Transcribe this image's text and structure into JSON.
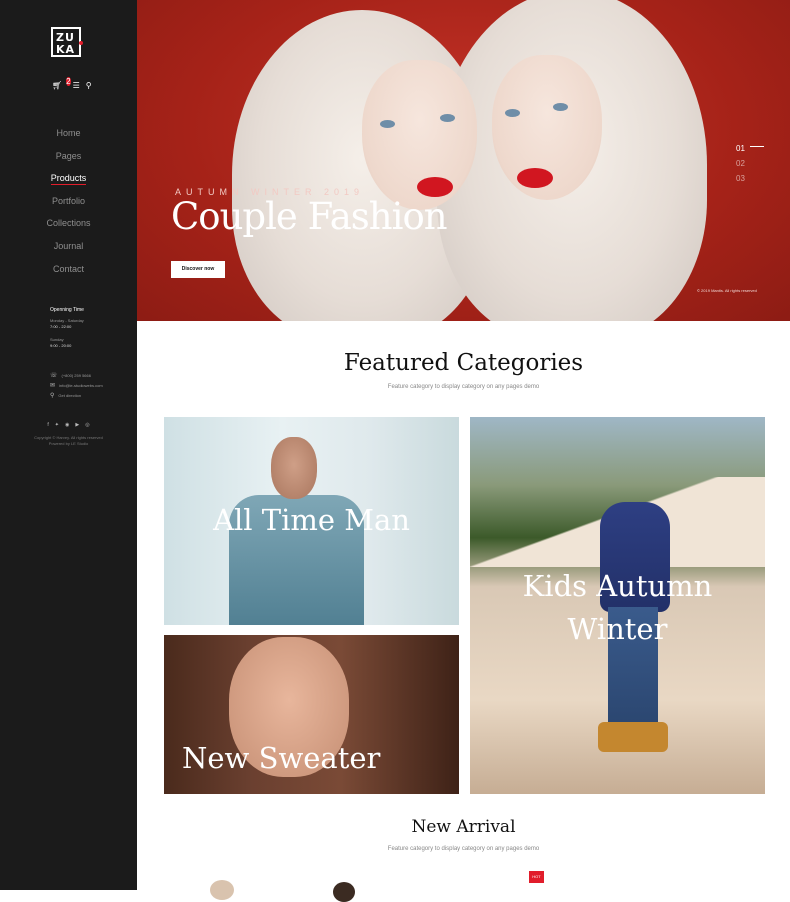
{
  "brand": {
    "line1": "ZU",
    "line2": "KA"
  },
  "header_icons": {
    "cart_count": "2"
  },
  "nav": [
    "Home",
    "Pages",
    "Products",
    "Portfolio",
    "Collections",
    "Journal",
    "Contact"
  ],
  "active_nav": "Products",
  "opening": {
    "title": "Openning Time",
    "weekdays": "Monday - Saturday",
    "weekday_hours": "7:00 - 22:00",
    "sunday": "Sunday",
    "sunday_hours": "9:00 - 20:00"
  },
  "contact": {
    "phone": "(+800) 259 5666",
    "email": "info@le-studiowebs.com",
    "direction": "Get direction"
  },
  "copyright": {
    "line1": "Copyright © Harvey. All rights reserved",
    "line2": "Powered by LE Studio"
  },
  "hero": {
    "subtitle": "AUTUMN WINTER 2019",
    "title": "Couple Fashion",
    "button": "Discover now",
    "slides": [
      "01",
      "02",
      "03"
    ],
    "rights": "© 2019 Mantis. All rights reserved"
  },
  "featured": {
    "title": "Featured Categories",
    "subtitle": "Feature category to display category on any pages demo",
    "tiles": [
      "All Time Man",
      "Kids Autumn Winter",
      "New Sweater"
    ]
  },
  "arrival": {
    "title": "New Arrival",
    "subtitle": "Feature category to display category on any pages demo",
    "badge": "HOT"
  },
  "colors": {
    "accent": "#e11d2b",
    "sidebar": "#1b1b1b",
    "hero": "#a52218"
  }
}
